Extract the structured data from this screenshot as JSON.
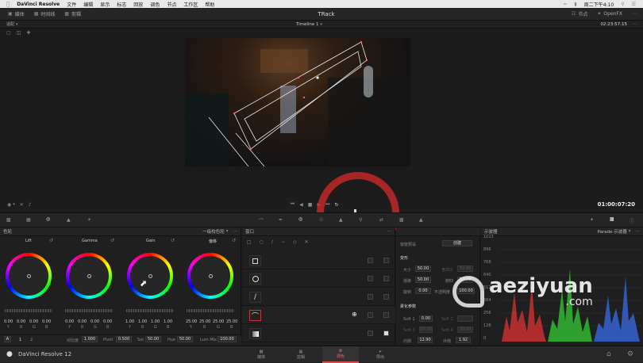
{
  "menubar": {
    "app": "DaVinci Resolve",
    "items": [
      "文件",
      "编辑",
      "显示",
      "标志",
      "回放",
      "调色",
      "节点",
      "工作区",
      "帮助"
    ],
    "clock": "周二下午4:10"
  },
  "topbar": {
    "media": "媒体",
    "timelines": "时间线",
    "clips": "剪辑",
    "project": "TRack",
    "nodes": "节点",
    "openfx": "OpenFX"
  },
  "viewer_header": {
    "mode": "适配",
    "timeline": "Timeline 1",
    "timecode": "02:23:57:15"
  },
  "transport": {
    "timecode": "01:00:07:20"
  },
  "wheels": {
    "title": "色轮",
    "mode": "一级校色轮",
    "items": [
      {
        "name": "Lift",
        "values": [
          "0.00",
          "0.00",
          "0.00",
          "0.00"
        ]
      },
      {
        "name": "Gamma",
        "values": [
          "0.00",
          "0.00",
          "0.00",
          "0.00"
        ]
      },
      {
        "name": "Gain",
        "values": [
          "1.00",
          "1.00",
          "1.00",
          "1.00"
        ]
      },
      {
        "name": "偏移",
        "values": [
          "25.00",
          "25.00",
          "25.00",
          "25.00"
        ]
      }
    ],
    "channels": [
      "Y",
      "R",
      "G",
      "B"
    ],
    "footer": {
      "a": "A",
      "p1": "1",
      "p2": "2",
      "contrast_l": "对比度",
      "contrast_v": "1.000",
      "pivot_l": "Pivot",
      "pivot_v": "0.500",
      "sat_l": "Sat",
      "sat_v": "50.00",
      "hue_l": "Hue",
      "hue_v": "50.00",
      "lummix_l": "Lum Mix",
      "lummix_v": "100.00"
    }
  },
  "window": {
    "title": "窗口",
    "shapes": [
      "square",
      "circle",
      "line",
      "curve",
      "gradient"
    ]
  },
  "props": {
    "preset_l": "窗窗预设",
    "create": "创建",
    "transform": "变形",
    "size_l": "大小",
    "size_v": "50.00",
    "aspect_l": "宽高比",
    "aspect_v": "50.00",
    "pan_l": "摇移",
    "pan_v": "50.00",
    "tilt_l": "俯仰",
    "tilt_v": "50.00",
    "rot_l": "旋转",
    "rot_v": "0.00",
    "opacity_l": "不透明度",
    "opacity_v": "100.00",
    "soft": "柔化参数",
    "soft1_l": "Soft 1",
    "soft1_v": "0.00",
    "soft2_l": "Soft 2",
    "soft2_v": "",
    "soft3_l": "Soft 3",
    "soft3_v": "50.00",
    "soft4_l": "Soft 4",
    "soft4_v": "50.00",
    "inner_l": "内侧",
    "inner_v": "12.90",
    "outer_l": "外侧",
    "outer_v": "1.92"
  },
  "scope": {
    "title": "示波器",
    "mode": "Parade 示波器",
    "ticks": [
      "1023",
      "896",
      "768",
      "640",
      "512",
      "384",
      "256",
      "128",
      "0"
    ]
  },
  "pages": {
    "app_name": "DaVinci Resolve 12",
    "items": [
      "媒体",
      "剪辑",
      "调色",
      "导出"
    ]
  },
  "watermark": {
    "text": "aeziyuan",
    ".com": ".com"
  },
  "colors": {
    "accent": "#c83a3a",
    "active_page": "#d24a4a",
    "highlight": "#e44"
  }
}
